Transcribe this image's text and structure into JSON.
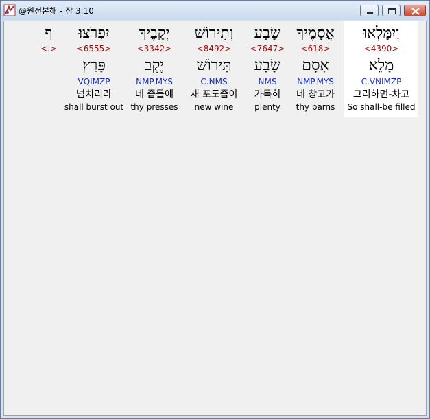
{
  "window": {
    "title": "@원전본해 - 잠 3:10"
  },
  "words": [
    {
      "hebrew": "וְיִמָּלְאוּ",
      "strong": "<4390>",
      "lemma": "מָלֵא",
      "morph": "C.VNIMZP",
      "korean": "그리하면-차고",
      "english": "So shall-be filled"
    },
    {
      "hebrew": "אֲסָמֶיךָ",
      "strong": "<618>",
      "lemma": "אָסָם",
      "morph": "NMP.MYS",
      "korean": "네 창고가",
      "english": "thy barns"
    },
    {
      "hebrew": "שָׂבָע",
      "strong": "<7647>",
      "lemma": "שָׂבָע",
      "morph": "NMS",
      "korean": "가득히",
      "english": "plenty"
    },
    {
      "hebrew": "וְתִירוֹשׁ",
      "strong": "<8492>",
      "lemma": "תִּירוֹשׁ",
      "morph": "C.NMS",
      "korean": "새 포도즙이",
      "english": "new wine"
    },
    {
      "hebrew": "יְקָבֶיךָ",
      "strong": "<3342>",
      "lemma": "יֶקֶב",
      "morph": "NMP.MYS",
      "korean": "네 즙틀에",
      "english": "thy presses"
    },
    {
      "hebrew": "יִפְרֹצוּ׃",
      "strong": "<6555>",
      "lemma": "פָּרַץ",
      "morph": "VQIMZP",
      "korean": "넘치리라",
      "english": "shall burst out"
    },
    {
      "hebrew": "ף",
      "strong": "<.>",
      "lemma": "",
      "morph": "",
      "korean": "",
      "english": ""
    }
  ]
}
